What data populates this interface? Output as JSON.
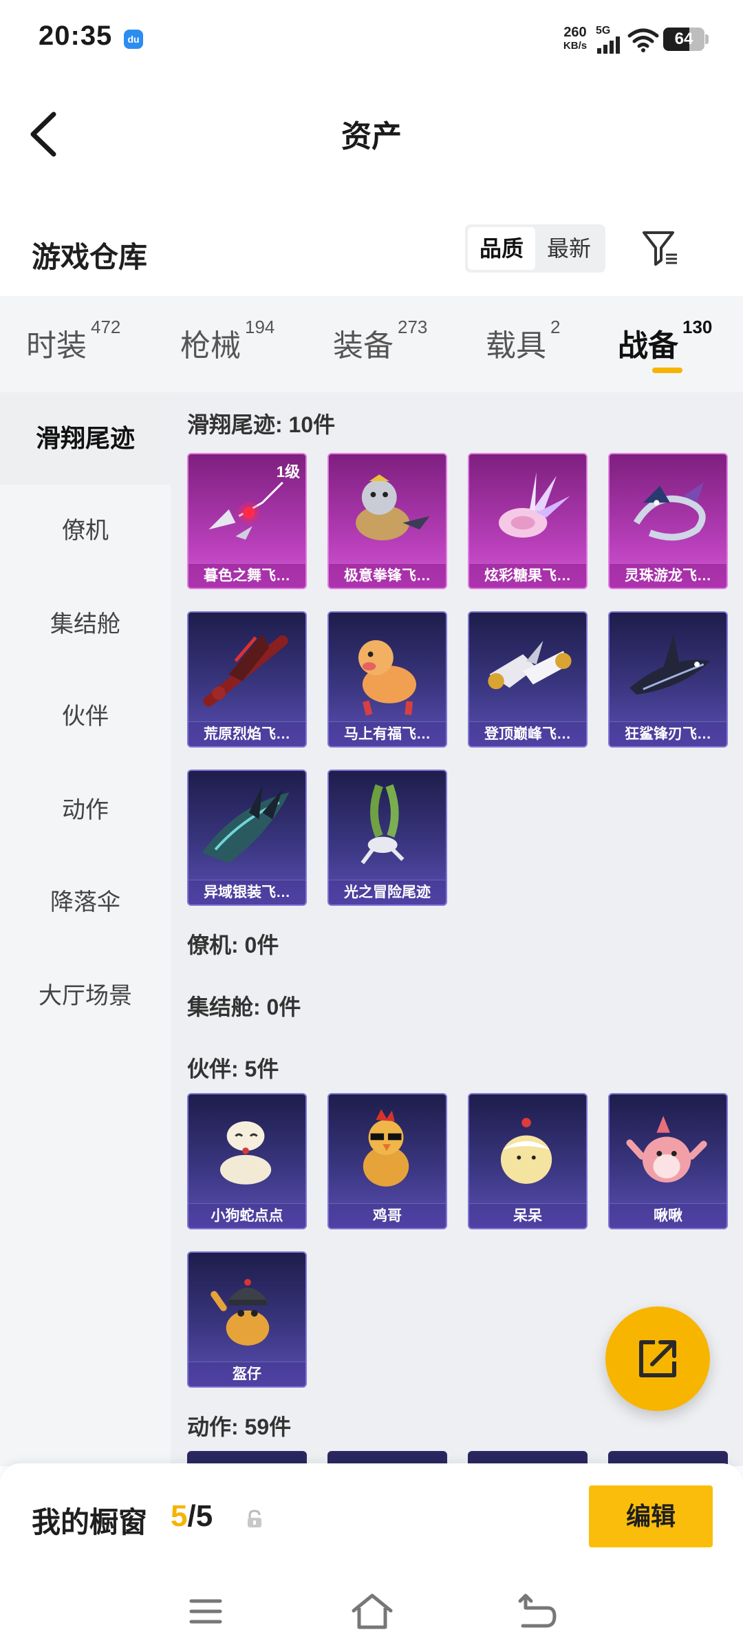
{
  "status_bar": {
    "time": "20:35",
    "app_icon_label": "du",
    "net_speed_value": "260",
    "net_speed_unit": "KB/s",
    "network_type": "5G",
    "battery_level": "64",
    "battery_fraction": 0.64
  },
  "header": {
    "title": "资产"
  },
  "warehouse": {
    "title": "游戏仓库",
    "sort_options": [
      "品质",
      "最新"
    ],
    "sort_selected": "品质"
  },
  "tabs": [
    {
      "label": "时装",
      "count": "472"
    },
    {
      "label": "枪械",
      "count": "194"
    },
    {
      "label": "装备",
      "count": "273"
    },
    {
      "label": "载具",
      "count": "2"
    },
    {
      "label": "战备",
      "count": "130",
      "active": true
    }
  ],
  "sidebar": [
    {
      "label": "滑翔尾迹",
      "active": true
    },
    {
      "label": "僚机"
    },
    {
      "label": "集结舱"
    },
    {
      "label": "伙伴"
    },
    {
      "label": "动作"
    },
    {
      "label": "降落伞"
    },
    {
      "label": "大厅场景"
    }
  ],
  "groups": {
    "trails": {
      "title": "滑翔尾迹: 10件",
      "items": [
        {
          "name": "暮色之舞飞…",
          "level": "1级",
          "rarity": "purple"
        },
        {
          "name": "极意拳锋飞…",
          "rarity": "purple"
        },
        {
          "name": "炫彩糖果飞…",
          "rarity": "purple"
        },
        {
          "name": "灵珠游龙飞…",
          "rarity": "purple"
        },
        {
          "name": "荒原烈焰飞…",
          "rarity": "blue"
        },
        {
          "name": "马上有福飞…",
          "rarity": "blue"
        },
        {
          "name": "登顶巅峰飞…",
          "rarity": "blue"
        },
        {
          "name": "狂鲨锋刃飞…",
          "rarity": "blue"
        },
        {
          "name": "异域银装飞…",
          "rarity": "blue"
        },
        {
          "name": "光之冒险尾迹",
          "rarity": "blue"
        }
      ]
    },
    "wingman": {
      "title": "僚机: 0件"
    },
    "pod": {
      "title": "集结舱: 0件"
    },
    "companions": {
      "title": "伙伴: 5件",
      "items": [
        {
          "name": "小狗蛇点点",
          "rarity": "blue"
        },
        {
          "name": "鸡哥",
          "rarity": "blue"
        },
        {
          "name": "呆呆",
          "rarity": "blue"
        },
        {
          "name": "啾啾",
          "rarity": "blue"
        },
        {
          "name": "盔仔",
          "rarity": "blue"
        }
      ]
    },
    "emotes": {
      "title": "动作: 59件"
    }
  },
  "showcase": {
    "title": "我的橱窗",
    "current": "5",
    "separator": "/",
    "total": "5",
    "edit_label": "编辑"
  },
  "colors": {
    "accent": "#f5b400",
    "purple_card": "#b13bb3",
    "blue_card": "#3a3680"
  }
}
